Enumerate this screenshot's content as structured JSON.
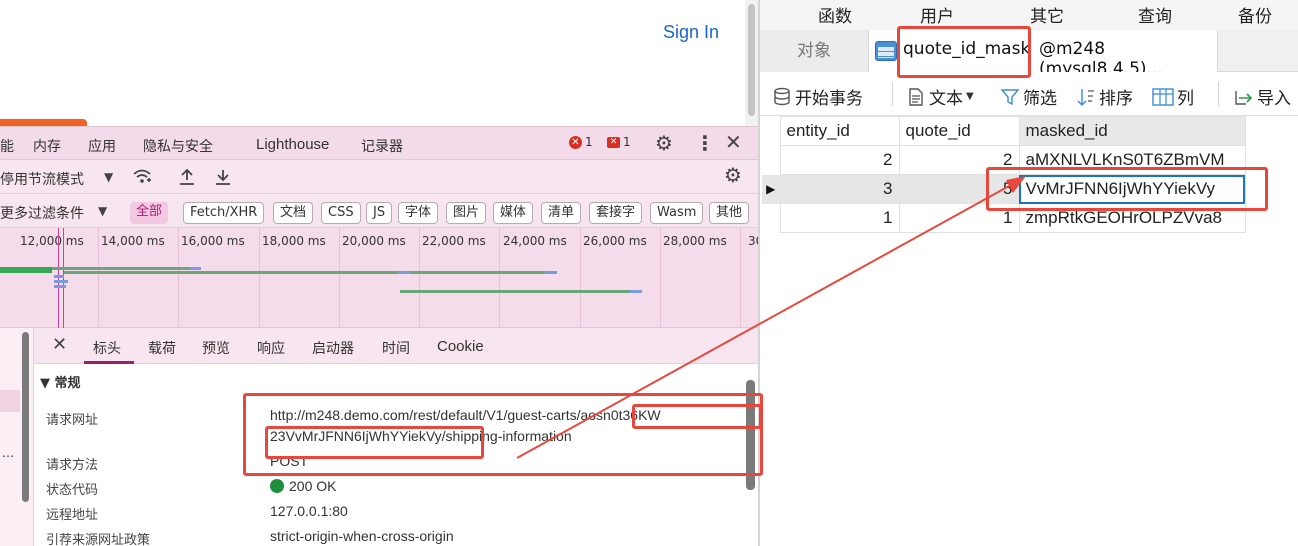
{
  "browser": {
    "sign_in": "Sign In"
  },
  "devtools": {
    "tabs": [
      "能",
      "内存",
      "应用",
      "隐私与安全",
      "Lighthouse",
      "记录器"
    ],
    "error_count": "1",
    "issue_count": "1",
    "throttle_label": "停用节流模式",
    "more_filters": "更多过滤条件",
    "filter_chips": [
      "全部",
      "Fetch/XHR",
      "文档",
      "CSS",
      "JS",
      "字体",
      "图片",
      "媒体",
      "清单",
      "套接字",
      "Wasm",
      "其他"
    ],
    "timeline_ticks": [
      "12,000 ms",
      "14,000 ms",
      "16,000 ms",
      "18,000 ms",
      "20,000 ms",
      "22,000 ms",
      "24,000 ms",
      "26,000 ms",
      "28,000 ms",
      "30"
    ],
    "left_list_ellipsis": "…",
    "detail_tabs": [
      "标头",
      "载荷",
      "预览",
      "响应",
      "启动器",
      "时间",
      "Cookie"
    ],
    "general_heading": "常规",
    "fields": {
      "request_url_label": "请求网址",
      "request_url_line1": "http://m248.demo.com/rest/default/V1/guest-carts/aosn0t36KW",
      "request_url_line2": "23VvMrJFNN6IjWhYYiekVy/shipping-information",
      "method_label": "请求方法",
      "method_value": "POST",
      "status_label": "状态代码",
      "status_value": "200 OK",
      "remote_label": "远程地址",
      "remote_value": "127.0.0.1:80",
      "referrer_label": "引荐来源网址政策",
      "referrer_value": "strict-origin-when-cross-origin"
    },
    "status_color": "#1e8e3e",
    "accent_color": "#9b1d6f"
  },
  "navicat": {
    "menu": [
      "函数",
      "用户",
      "其它",
      "查询",
      "备份"
    ],
    "tab_objects": "对象",
    "tab_table": "quote_id_mask",
    "tab_conn": "@m248 (mysql8.4.5)...",
    "toolbar": {
      "begin_tx": "开始事务",
      "text": "文本",
      "filter": "筛选",
      "sort": "排序",
      "columns": "列",
      "import": "导入"
    },
    "columns": [
      "entity_id",
      "quote_id",
      "masked_id"
    ],
    "rows": [
      {
        "entity_id": "2",
        "quote_id": "2",
        "masked_id": "aMXNLVLKnS0T6ZBmVM"
      },
      {
        "entity_id": "3",
        "quote_id": "5",
        "masked_id": "VvMrJFNN6IjWhYYiekVy"
      },
      {
        "entity_id": "1",
        "quote_id": "1",
        "masked_id": "zmpRtkGEOHrOLPZVva8"
      }
    ],
    "current_row_marker": "▶"
  },
  "annotation_color": "#e8483c"
}
